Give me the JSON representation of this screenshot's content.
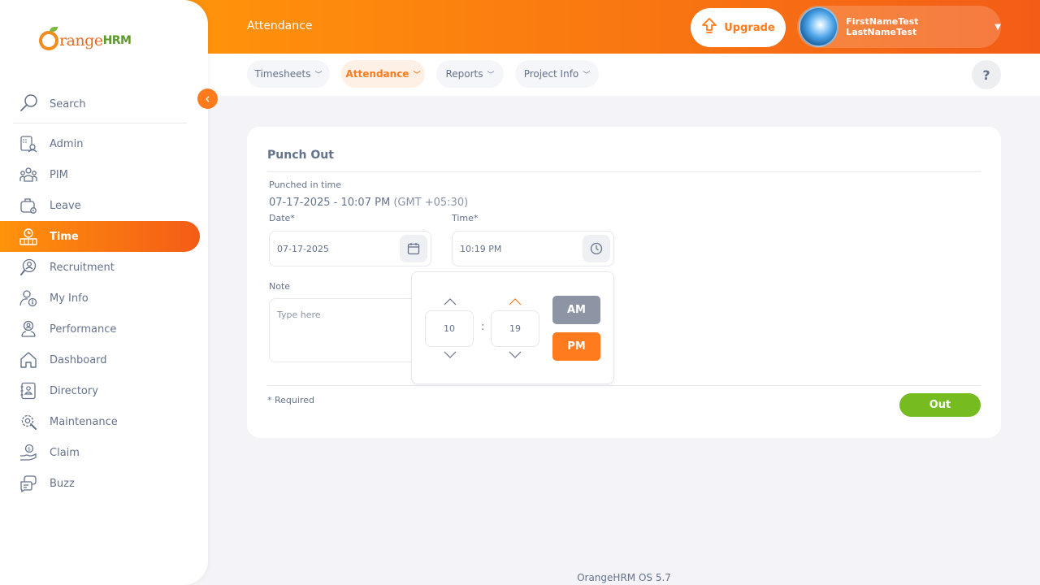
{
  "brand": {
    "orange": "range",
    "hrm": "HRM"
  },
  "sidebar": {
    "search_label": "Search",
    "items": [
      {
        "label": "Admin",
        "icon": "admin-icon"
      },
      {
        "label": "PIM",
        "icon": "pim-icon"
      },
      {
        "label": "Leave",
        "icon": "leave-icon"
      },
      {
        "label": "Time",
        "icon": "time-icon",
        "active": true
      },
      {
        "label": "Recruitment",
        "icon": "recruitment-icon"
      },
      {
        "label": "My Info",
        "icon": "my-info-icon"
      },
      {
        "label": "Performance",
        "icon": "performance-icon"
      },
      {
        "label": "Dashboard",
        "icon": "dashboard-icon"
      },
      {
        "label": "Directory",
        "icon": "directory-icon"
      },
      {
        "label": "Maintenance",
        "icon": "maintenance-icon"
      },
      {
        "label": "Claim",
        "icon": "claim-icon"
      },
      {
        "label": "Buzz",
        "icon": "buzz-icon"
      }
    ]
  },
  "header": {
    "title": "Attendance",
    "upgrade_label": "Upgrade",
    "user_name": "FirstNameTest LastNameTest"
  },
  "tabs": [
    {
      "label": "Timesheets"
    },
    {
      "label": "Attendance",
      "active": true
    },
    {
      "label": "Reports"
    },
    {
      "label": "Project Info"
    }
  ],
  "help_label": "?",
  "form": {
    "title": "Punch Out",
    "punched_in_label": "Punched in time",
    "punched_in_value": "07-17-2025 - 10:07 PM",
    "punched_in_tz": "(GMT +05:30)",
    "date_label": "Date*",
    "date_value": "07-17-2025",
    "time_label": "Time*",
    "time_value": "10:19 PM",
    "note_label": "Note",
    "note_placeholder": "Type here",
    "required_text": "* Required",
    "out_label": "Out"
  },
  "time_picker": {
    "hour": "10",
    "minute": "19",
    "separator": ":",
    "am_label": "AM",
    "pm_label": "PM",
    "selected_period": "PM"
  },
  "footer": "OrangeHRM OS 5.7",
  "colors": {
    "accent": "#ff7b1d",
    "accent_gradient_start": "#ff920b",
    "accent_gradient_end": "#f35c17",
    "success": "#76bc21",
    "am_inactive": "#8d95a5"
  }
}
